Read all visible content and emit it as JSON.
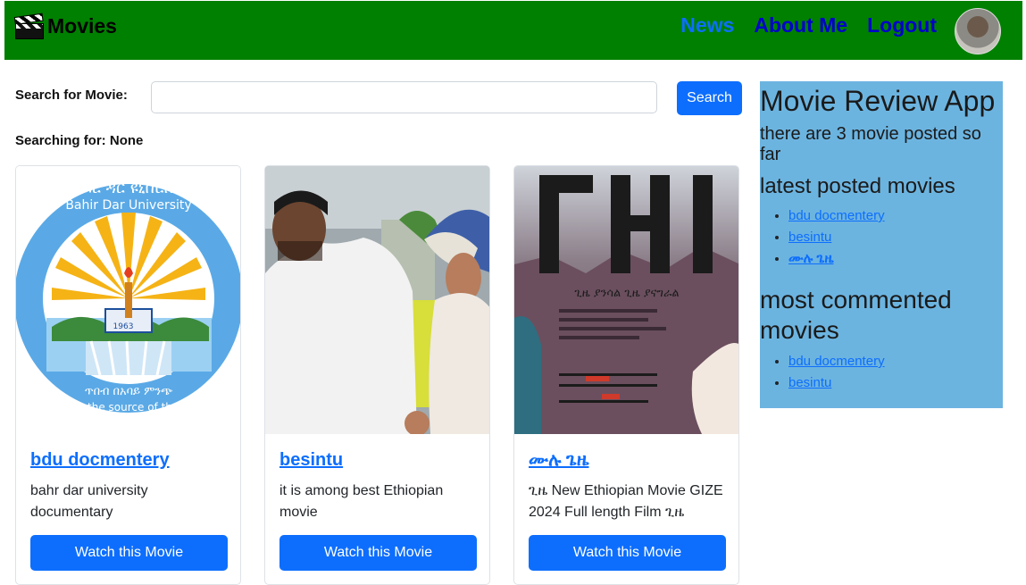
{
  "nav": {
    "brand": "Movies",
    "links": [
      "News",
      "About Me",
      "Logout"
    ]
  },
  "search": {
    "label": "Search for Movie:",
    "value": "",
    "button": "Search",
    "status_prefix": "Searching for: ",
    "status_value": "None"
  },
  "cards": [
    {
      "title": "bdu docmentery",
      "description": "bahr dar university documentary",
      "button": "Watch this Movie",
      "image_text": [
        "ባሕር ዳር ዩኒቨርሲቲ",
        "Bahir Dar University",
        "1963",
        "Wisdom at the source of the Blue Nile",
        "ጥበብ በአባይ ምንጭ"
      ]
    },
    {
      "title": "besintu",
      "description": "it is among best Ethiopian movie",
      "button": "Watch this Movie"
    },
    {
      "title": "ሙሉ ጌዜ",
      "description": "ጊዜ New Ethiopian Movie GIZE 2024 Full length Film ጊዜ",
      "button": "Watch this Movie",
      "image_text": [
        "ጊዜ",
        "ጊዜ ያንሳል ጊዜ ያናግራል"
      ]
    }
  ],
  "sidebar": {
    "title": "Movie Review App",
    "count_text": "there are 3 movie posted so far",
    "latest_heading": "latest posted movies",
    "latest": [
      "bdu docmentery",
      "besintu",
      "ሙሉ ጌዜ"
    ],
    "most_heading": "most commented movies",
    "most": [
      "bdu docmentery",
      "besintu"
    ]
  },
  "colors": {
    "navbar": "#008000",
    "primary": "#0d6efd",
    "sidebar": "#6cb4e0"
  }
}
